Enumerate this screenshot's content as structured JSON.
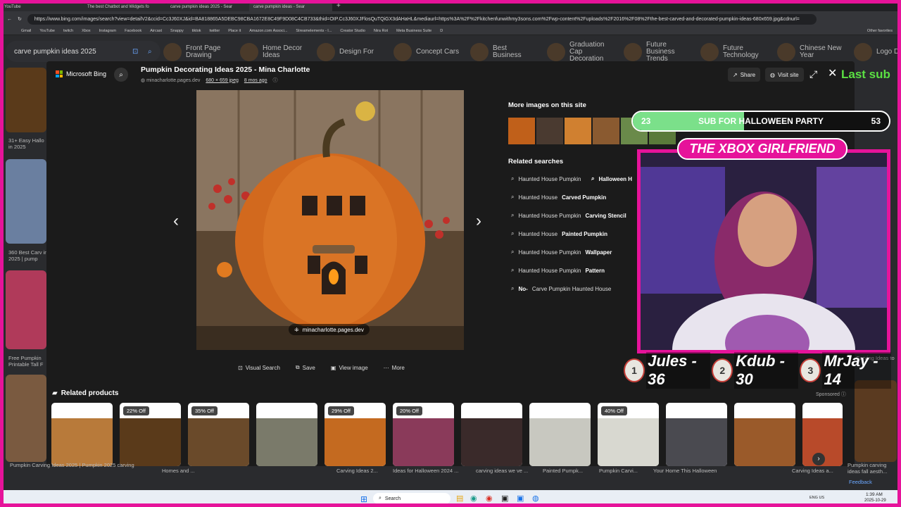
{
  "browser": {
    "tabs": [
      {
        "title": "YouTube",
        "active": false
      },
      {
        "title": "The best Chatbot and Widgets fo",
        "active": false
      },
      {
        "title": "carve pumpkin ideas 2025 - Sear",
        "active": false
      },
      {
        "title": "carve pumpkin ideas - Sear",
        "active": true
      }
    ],
    "url": "https://www.bing.com/images/search?view=detailV2&ccid=Cc3J60XJ&id=BA818865A5DEBC98CBA1672E8C49F9D08C4CB733&thid=OIP.Cc3J60XJFlosQuTQiGX3dAHaHL&mediaurl=https%3A%2F%2Fkitchenfunwithmy3sons.com%2Fwp-content%2Fuploads%2F2016%2F08%2Fthe-best-carved-and-decorated-pumpkin-ideas-680x659.jpg&cdnurl=",
    "bookmarks": [
      "Gmail",
      "YouTube",
      "twitch",
      "Xbox",
      "Instagram",
      "Facebook",
      "Aircast",
      "Snappy",
      "tiktok",
      "twitter",
      "Place it",
      "Amazon.com Associ...",
      "Streamelements - I...",
      "Creator Studio",
      "Nira Rot",
      "Meta Business Suite",
      "D"
    ],
    "other_favorites": "Other favorites"
  },
  "bing": {
    "search_query": "carve pumpkin ideas 2025",
    "chips": [
      {
        "label": "Front Page Drawing"
      },
      {
        "label": "Home Decor Ideas"
      },
      {
        "label": "Design For"
      },
      {
        "label": "Concept Cars"
      },
      {
        "label": "Best Business"
      },
      {
        "label": "Graduation Cap Decoration"
      },
      {
        "label": "Future Business Trends"
      },
      {
        "label": "Future Technology"
      },
      {
        "label": "Chinese New Year"
      },
      {
        "label": "Logo Design"
      }
    ],
    "left_caption_1": "31+ Easy Hallo in 2025",
    "left_caption_2": "360 Best Carv in 2025 | pump",
    "left_caption_3": "Free Pumpkin Printable Tall F",
    "right_caption_1": "Pumpkin",
    "right_caption_2": "Carving Ideas to"
  },
  "viewer": {
    "brand": "Microsoft Bing",
    "title": "Pumpkin Decorating Ideas 2025 - Mina Charlotte",
    "source_domain": "minacharlotte.pages.dev",
    "dimensions": "680 × 659 jpeg",
    "age": "8 mos ago",
    "share_label": "Share",
    "visit_site_label": "Visit site",
    "image_source_pill": "minacharlotte.pages.dev",
    "actions": {
      "visual_search": "Visual Search",
      "save": "Save",
      "view_image": "View image",
      "more": "More"
    },
    "more_images_title": "More images on this site",
    "related_searches_title": "Related searches",
    "related_searches": [
      {
        "prefix": "Haunted House Pumpkin",
        "bold": ""
      },
      {
        "prefix": "Haunted House",
        "bold": "Carved Pumpkin"
      },
      {
        "prefix": "Haunted House Pumpkin",
        "bold": "Carving Stencil"
      },
      {
        "prefix": "Haunted House",
        "bold": "Painted Pumpkin"
      },
      {
        "prefix": "Haunted House Pumpkin",
        "bold": "Wallpaper"
      },
      {
        "prefix": "Haunted House Pumpkin",
        "bold": "Pattern"
      },
      {
        "prefix": "Carve Pumpkin Haunted House",
        "bold": "No-"
      }
    ],
    "related_search_col2": "Halloween H",
    "related_products_title": "Related products",
    "sponsored": "Sponsored",
    "products": [
      {
        "badge": "",
        "caption": "Pumpkin Carving Ideas 2025 | Pumpkin 2025 carving"
      },
      {
        "badge": "22% Off",
        "caption": "Homes and ..."
      },
      {
        "badge": "35% Off",
        "caption": ""
      },
      {
        "badge": "",
        "caption": ""
      },
      {
        "badge": "29% Off",
        "caption": "Carving Ideas 2..."
      },
      {
        "badge": "20% Off",
        "caption": "Ideas for Halloween 2024 ..."
      },
      {
        "badge": "",
        "caption": "carving ideas we ve ..."
      },
      {
        "badge": "",
        "caption": "Painted Pumpk..."
      },
      {
        "badge": "40% Off",
        "caption": "Pumpkin Carvi..."
      },
      {
        "badge": "",
        "caption": "Your Home This Halloween"
      },
      {
        "badge": "",
        "caption": "Carving Ideas a..."
      },
      {
        "badge": "",
        "caption": ""
      }
    ],
    "right_edge_caption": "Pumpkin carving ideas fall aesth...",
    "feedback": "Feedback"
  },
  "stream": {
    "sub_goal_current": "23",
    "sub_goal_text": "SUB FOR HALLOWEEN PARTY",
    "sub_goal_target": "53",
    "sub_goal_progress": 0.434,
    "streamer_name": "THE XBOX GIRLFRIEND",
    "last_sub_label": "Last sub",
    "leaderboard": [
      {
        "rank": "1",
        "entry": "Jules - 36"
      },
      {
        "rank": "2",
        "entry": "Kdub - 30"
      },
      {
        "rank": "3",
        "entry": "MrJay - 14"
      }
    ]
  },
  "taskbar": {
    "search_label": "Search",
    "lang": "ENG US",
    "time": "1:39 AM",
    "date": "2025-10-29"
  },
  "colors": {
    "stream_accent": "#e6139a",
    "goal_fill": "#7be08a",
    "last_sub_text": "#5be043"
  }
}
